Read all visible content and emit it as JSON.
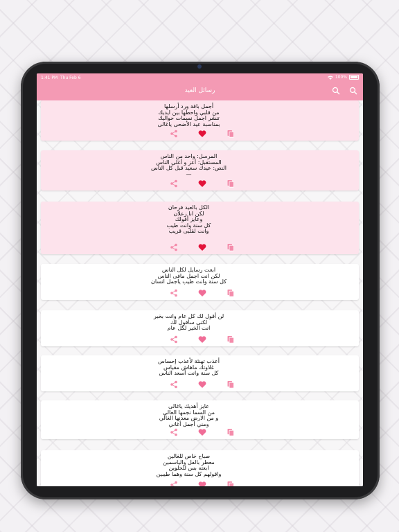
{
  "status": {
    "time": "1:41 PM",
    "date": "Thu Feb 6",
    "battery": "100%"
  },
  "header": {
    "title": "رسائل العيد"
  },
  "colors": {
    "accent": "#f49ab4",
    "heart_active": "#e3133a",
    "heart_inactive": "#f06d97",
    "icon": "#f48cab"
  },
  "messages": [
    {
      "text": "أجمل باقة ورد أرسلها\nمن قلبي واحطها بين ايديك\nتنشر اجمل نسمات حواليك\nبمناسبة عيد الأضحى ياغالى",
      "favorite": true
    },
    {
      "text": "المرسل: واحد من الناس\nالمستقبل: أعز و أغلى الناس\nالنص: عيدك سعيد قبل كل الناس\n—",
      "favorite": true
    },
    {
      "text": "الكل بالعيد فرحان\nلكن انا زعلان\nوعايز أقولك\nكل سنة وانت طيب\nوانت لقلبى قريب",
      "favorite": true
    },
    {
      "text": "ابعت رسايل لكل الناس\nلكن انت اجمل مافى الناس\nكل سنة وانت طيب ياجمل انسان",
      "favorite": false
    },
    {
      "text": "لن أقول لك كل عام وانت بخير\nلكنى سأقول لك\nانت الخير لكل عام",
      "favorite": false
    },
    {
      "text": "أعذب تهنئة لأعذب إحساس\nغلاوتك ماهاش مقياس\nكل سنة وانت أسعد الناس",
      "favorite": false
    },
    {
      "text": "عايز أهديك ياغالى\nمن السما نجمها العالي\nو من الارض معدنها الغالي\nومني أجمل أغاني",
      "favorite": false
    },
    {
      "text": "صباح خاص للغالين\nمعطر بالفل والياسمين\nابعته بس للحلوين\nواقولهم كل سنة وهما طيبين",
      "favorite": false
    }
  ]
}
